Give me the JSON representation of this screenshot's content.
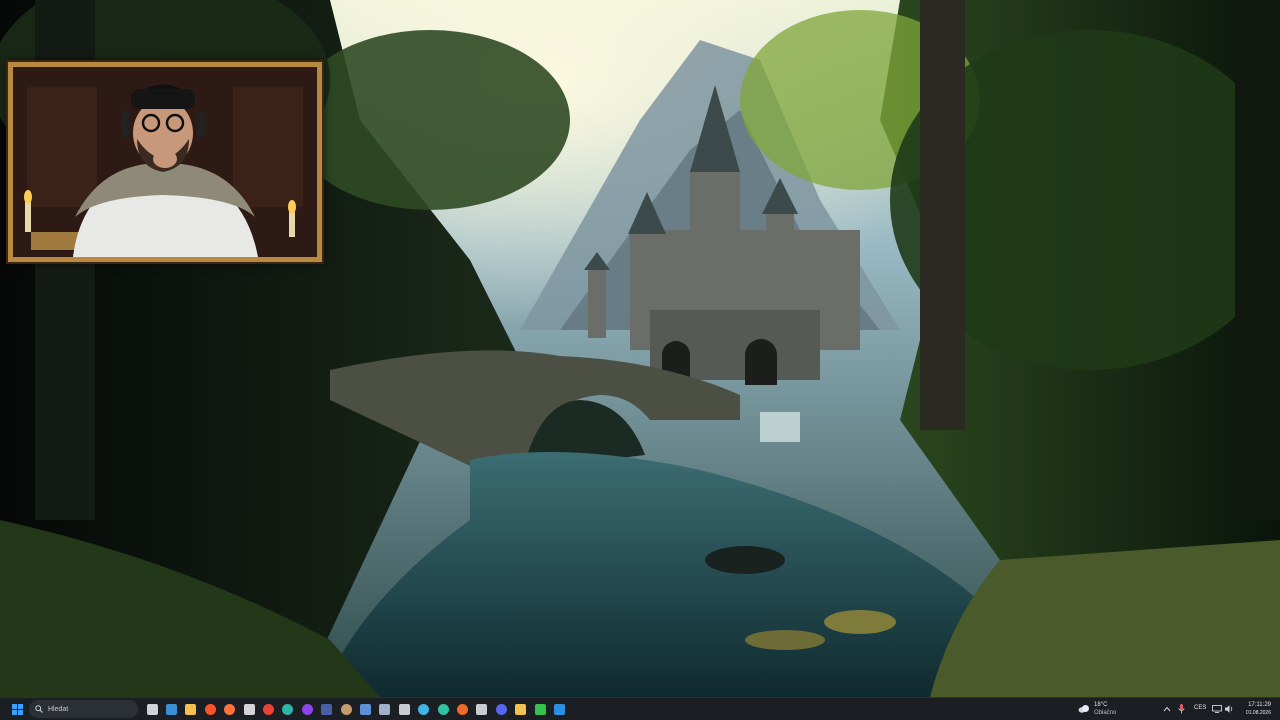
{
  "taskbar": {
    "search": {
      "placeholder": "Hledat"
    },
    "pinned_apps": [
      {
        "name": "task-view-icon",
        "color": "#d0d4d8"
      },
      {
        "name": "steam-icon",
        "color": "#3b8fd6"
      },
      {
        "name": "file-explorer-icon",
        "color": "#f2c14e"
      },
      {
        "name": "brave-icon",
        "color": "#fb542b"
      },
      {
        "name": "firefox-icon",
        "color": "#ff7139"
      },
      {
        "name": "music-icon",
        "color": "#d4d4d4"
      },
      {
        "name": "chrome-icon",
        "color": "#ea4335"
      },
      {
        "name": "edge-icon",
        "color": "#2fb5a5"
      },
      {
        "name": "streaming-app-icon",
        "color": "#8e44ec"
      },
      {
        "name": "app-icon-dark",
        "color": "#4a5fa8"
      },
      {
        "name": "app-icon-avatar",
        "color": "#c69c6d"
      },
      {
        "name": "app-icon-tool",
        "color": "#5b8fd6"
      },
      {
        "name": "app-icon-pen",
        "color": "#9fb0c8"
      },
      {
        "name": "app-icon-cube",
        "color": "#c9ccd0"
      },
      {
        "name": "app-icon-globe",
        "color": "#3db5e6"
      },
      {
        "name": "app-icon-swirl",
        "color": "#2fc1a5"
      },
      {
        "name": "app-icon-browser",
        "color": "#f06a2a"
      },
      {
        "name": "app-icon-database",
        "color": "#c9ccd0"
      },
      {
        "name": "app-icon-discord",
        "color": "#5865f2"
      },
      {
        "name": "app-icon-arrow",
        "color": "#f2c14e"
      },
      {
        "name": "app-icon-play",
        "color": "#35c24a"
      },
      {
        "name": "vscode-icon",
        "color": "#2a8fe0"
      }
    ],
    "weather": {
      "temperature": "18°C",
      "condition": "Oblačno",
      "icon": "cloud-icon"
    },
    "tray": {
      "language": "CES"
    },
    "clock": {
      "time": "17:11:29",
      "date": "01.08.2026"
    }
  }
}
